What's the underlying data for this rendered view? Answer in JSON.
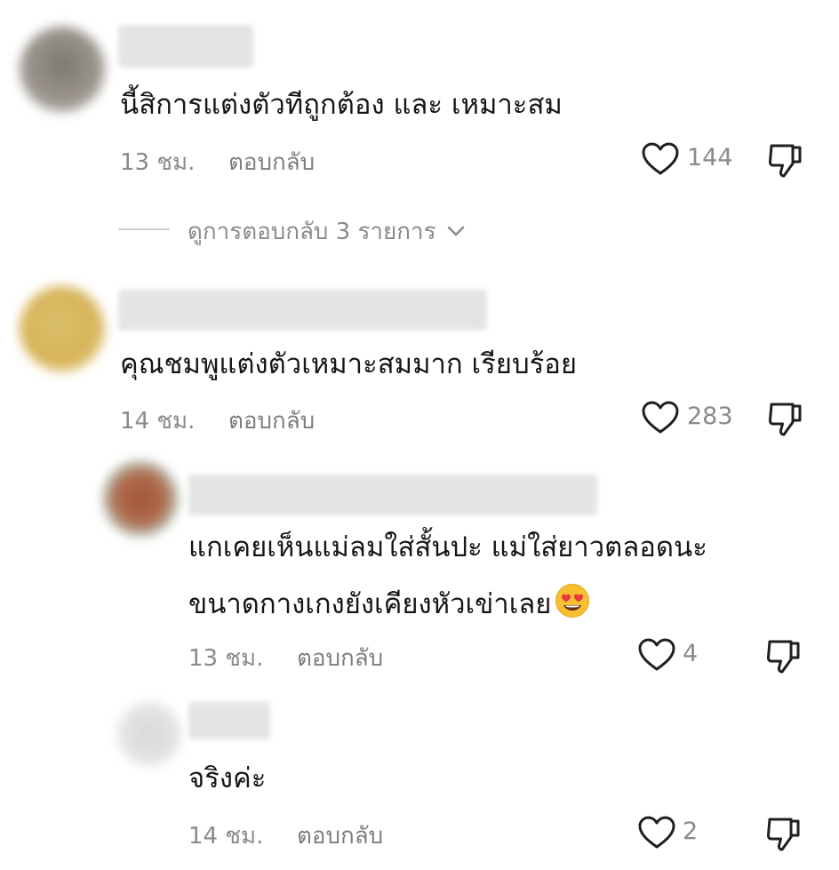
{
  "comments": [
    {
      "text": "นี้สิการแต่งตัวทีถูกต้อง และ เหมาะสม",
      "time": "13 ชม.",
      "reply_label": "ตอบกลับ",
      "likes": "144"
    },
    {
      "text": "คุณชมพูแต่งตัวเหมาะสมมาก เรียบร้อย",
      "time": "14 ชม.",
      "reply_label": "ตอบกลับ",
      "likes": "283",
      "replies": [
        {
          "text_line1": "แกเคยเห็นแม่ลมใส่สั้นปะ แม่ใส่ยาวตลอดนะ",
          "text_line2": "ขนาดกางเกงยังเคียงหัวเข่าเลย",
          "emoji": "heart-eyes-emoji",
          "time": "13 ชม.",
          "reply_label": "ตอบกลับ",
          "likes": "4"
        },
        {
          "text": "จริงค่ะ",
          "time": "14 ชม.",
          "reply_label": "ตอบกลับ",
          "likes": "2"
        }
      ]
    }
  ],
  "view_replies_label": "ดูการตอบกลับ 3 รายการ",
  "icons": {
    "like": "heart-outline-icon",
    "dislike": "thumbs-down-icon",
    "expand": "chevron-down-icon"
  },
  "colors": {
    "text": "#161616",
    "meta": "#8a8a8a",
    "icon": "#1f1f1f"
  }
}
